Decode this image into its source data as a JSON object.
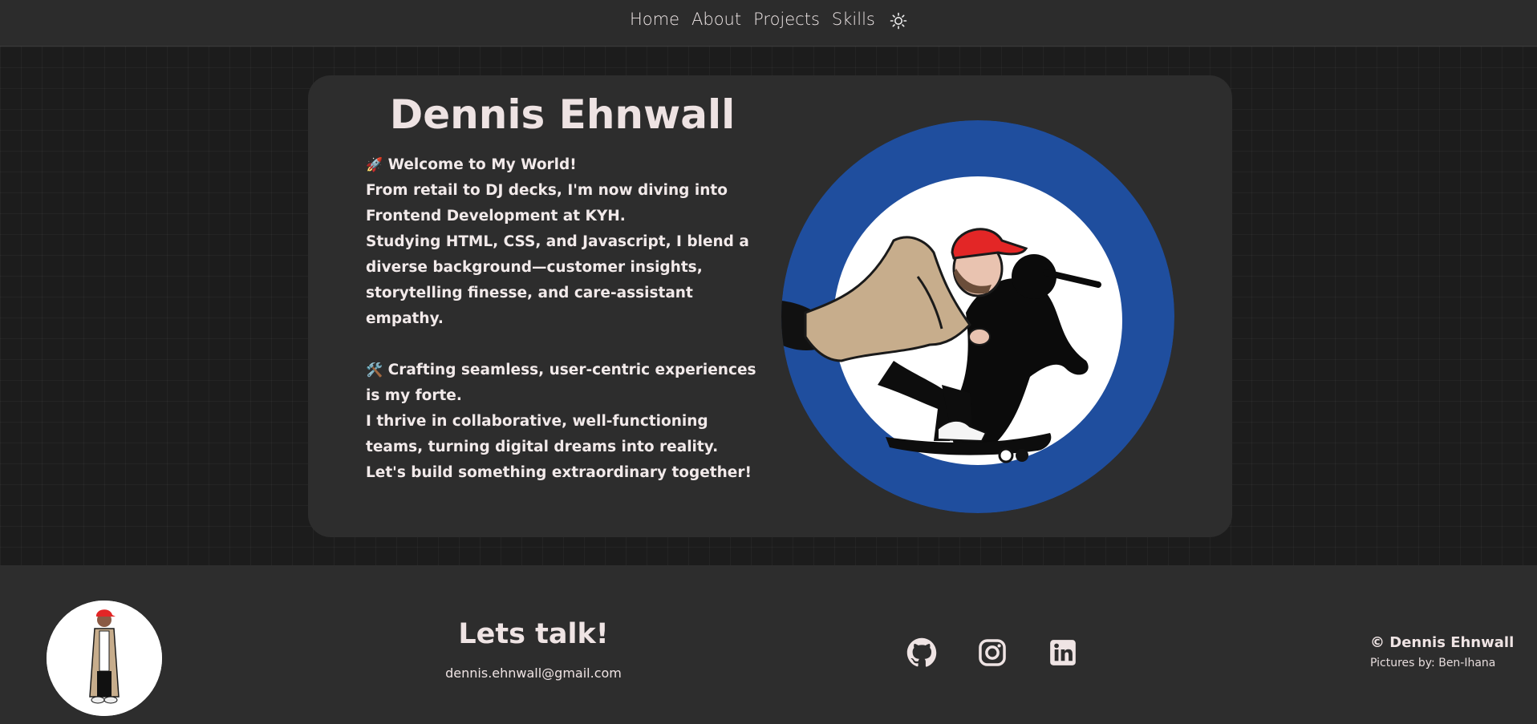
{
  "nav": {
    "links": [
      "Home",
      "About",
      "Projects",
      "Skills"
    ],
    "theme_icon": "sun-icon"
  },
  "hero": {
    "name": "Dennis Ehnwall",
    "welcome_emoji": "🚀",
    "welcome": "Welcome to My World!",
    "line1": "From retail to DJ decks, I'm now diving into Frontend Development at KYH.",
    "line2": "Studying HTML, CSS, and Javascript, I blend a diverse background—customer insights, storytelling finesse, and care-assistant empathy.",
    "craft_emoji": "🛠️",
    "craft": "Crafting seamless, user-centric experiences is my forte.",
    "line3": "I thrive in collaborative, well-functioning teams, turning digital dreams into reality. Let's build something extraordinary together!",
    "image_icon": "skateboarder-illustration"
  },
  "footer": {
    "talk": "Lets talk!",
    "email": "dennis.ehnwall@gmail.com",
    "socials": [
      "github-icon",
      "instagram-icon",
      "linkedin-icon"
    ],
    "copyright": "© Dennis Ehnwall",
    "credits": "Pictures by: Ben-Ihana"
  },
  "colors": {
    "background": "#1d1d1d",
    "panel": "#2d2d2d",
    "text": "#f1e6e6",
    "ring_blue": "#1f4e9e",
    "cap_red": "#e32626",
    "coat_tan": "#c7ad8c"
  }
}
